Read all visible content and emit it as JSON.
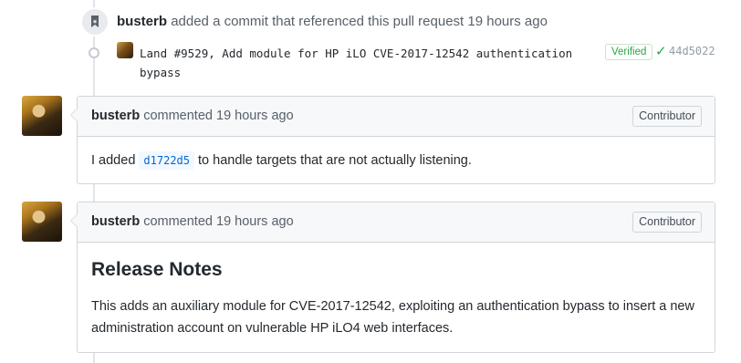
{
  "event": {
    "author": "busterb",
    "action": "added a commit that referenced this pull request",
    "time": "19 hours ago"
  },
  "commit": {
    "message": "Land #9529, Add module for HP iLO CVE-2017-12542 authentication bypass",
    "verified_label": "Verified",
    "check_glyph": "✓",
    "sha": "44d5022"
  },
  "comments": [
    {
      "author": "busterb",
      "action": "commented",
      "time": "19 hours ago",
      "role": "Contributor",
      "body_before": "I added",
      "sha_link": "d1722d5",
      "body_after": "to handle targets that are not actually listening."
    },
    {
      "author": "busterb",
      "action": "commented",
      "time": "19 hours ago",
      "role": "Contributor",
      "heading": "Release Notes",
      "body": "This adds an auxiliary module for CVE-2017-12542, exploiting an authentication bypass to insert a new administration account on vulnerable HP iLO4 web interfaces."
    }
  ],
  "icons": {
    "event": "bookmark-icon",
    "commit": "git-commit-icon",
    "check": "check-icon"
  },
  "colors": {
    "link": "#0366d6",
    "verified": "#28a745",
    "muted": "#586069"
  }
}
